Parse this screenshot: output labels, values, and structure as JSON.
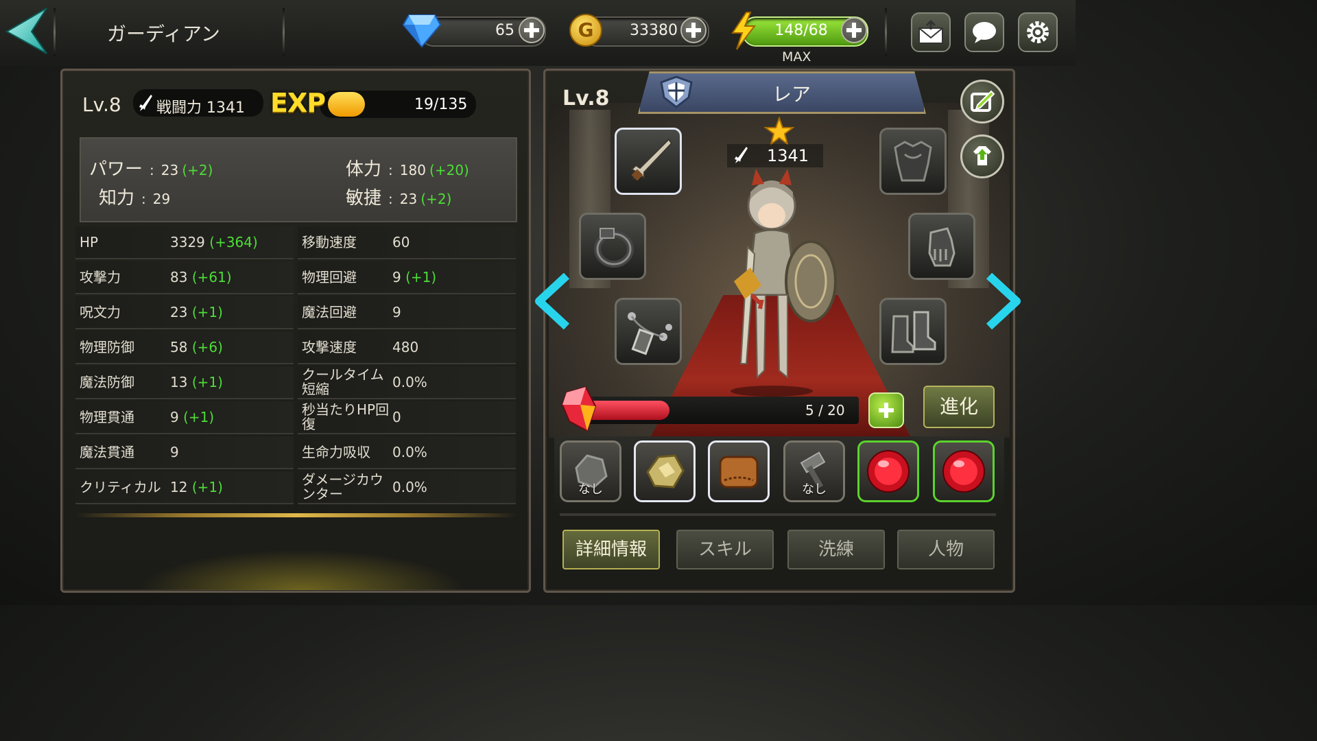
{
  "header": {
    "title": "ガーディアン",
    "gems": "65",
    "gold": "33380",
    "stamina": "148/68",
    "stamina_status": "MAX"
  },
  "left": {
    "level": "Lv.8",
    "combat_power": "戦闘力 1341",
    "exp_label": "EXP",
    "exp_value": "19/135",
    "exp_progress": 0.14,
    "attrs": [
      {
        "label": "パワー",
        "sep": ":",
        "value": "23",
        "bonus": "(+2)"
      },
      {
        "label": "知力",
        "sep": ":",
        "value": "29",
        "bonus": ""
      },
      {
        "label": "体力",
        "sep": ":",
        "value": "180",
        "bonus": "(+20)"
      },
      {
        "label": "敏捷",
        "sep": ":",
        "value": "23",
        "bonus": "(+2)"
      }
    ],
    "stats_left": [
      {
        "name": "HP",
        "value": "3329",
        "bonus": "(+364)"
      },
      {
        "name": "攻撃力",
        "value": "83",
        "bonus": "(+61)"
      },
      {
        "name": "呪文力",
        "value": "23",
        "bonus": "(+1)"
      },
      {
        "name": "物理防御",
        "value": "58",
        "bonus": "(+6)"
      },
      {
        "name": "魔法防御",
        "value": "13",
        "bonus": "(+1)"
      },
      {
        "name": "物理貫通",
        "value": "9",
        "bonus": "(+1)"
      },
      {
        "name": "魔法貫通",
        "value": "9",
        "bonus": ""
      },
      {
        "name": "クリティカル",
        "value": "12",
        "bonus": "(+1)"
      }
    ],
    "stats_right": [
      {
        "name": "移動速度",
        "value": "60",
        "bonus": ""
      },
      {
        "name": "物理回避",
        "value": "9",
        "bonus": "(+1)"
      },
      {
        "name": "魔法回避",
        "value": "9",
        "bonus": ""
      },
      {
        "name": "攻撃速度",
        "value": "480",
        "bonus": ""
      },
      {
        "name": "クールタイム短縮",
        "value": "0.0%",
        "bonus": ""
      },
      {
        "name": "秒当たりHP回復",
        "value": "0",
        "bonus": ""
      },
      {
        "name": "生命力吸収",
        "value": "0.0%",
        "bonus": ""
      },
      {
        "name": "ダメージカウンター",
        "value": "0.0%",
        "bonus": ""
      }
    ]
  },
  "right": {
    "level": "Lv.8",
    "rarity": "レア",
    "combat_power": "1341",
    "evolve_progress": "5 / 20",
    "evolve_fraction": 0.25,
    "evolve_label": "進化",
    "gem_slots": [
      {
        "label": "なし"
      },
      {
        "label": ""
      },
      {
        "label": ""
      },
      {
        "label": "なし"
      },
      {
        "label": ""
      },
      {
        "label": ""
      }
    ],
    "tabs": [
      "詳細情報",
      "スキル",
      "洗練",
      "人物"
    ]
  },
  "colors": {
    "bonus": "#4dde38",
    "exp_yellow": "#ffdc2a",
    "stamina_green": "#7fd81e",
    "accent_cyan": "#1ec8e0",
    "rarity_blue": "#46537a"
  }
}
